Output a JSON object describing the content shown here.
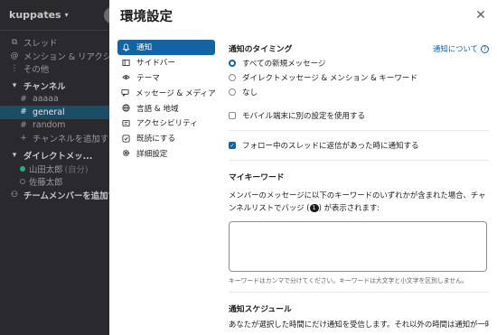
{
  "workspace": {
    "name": "kuppates",
    "nav": [
      {
        "label": "スレッド",
        "icon": "threads-icon"
      },
      {
        "label": "メンション & リアクション",
        "icon": "mention-icon"
      },
      {
        "label": "その他",
        "icon": "more-icon"
      }
    ],
    "channels_header": "チャンネル",
    "channels": [
      "aaaaa",
      "general",
      "random"
    ],
    "active_channel": "general",
    "add_channel": "チャンネルを追加する",
    "dm_header": "ダイレクトメッ...",
    "dms": [
      {
        "name": "山田太郎",
        "suffix": "(自分)",
        "online": true
      },
      {
        "name": "佐藤太郎",
        "suffix": "",
        "online": false
      }
    ],
    "add_member": "チームメンバーを追加する"
  },
  "modal": {
    "title": "環境設定",
    "close_icon": "close-icon",
    "nav": [
      {
        "label": "通知",
        "icon": "bell-icon",
        "active": true
      },
      {
        "label": "サイドバー",
        "icon": "sidebar-icon"
      },
      {
        "label": "テーマ",
        "icon": "eye-icon"
      },
      {
        "label": "メッセージ & メディア",
        "icon": "message-icon"
      },
      {
        "label": "言語 & 地域",
        "icon": "globe-icon"
      },
      {
        "label": "アクセシビリティ",
        "icon": "accessibility-icon"
      },
      {
        "label": "既読にする",
        "icon": "check-icon"
      },
      {
        "label": "詳細設定",
        "icon": "gear-icon"
      }
    ],
    "timing": {
      "title": "通知のタイミング",
      "help": "通知について",
      "options": [
        {
          "label": "すべての新規メッセージ",
          "selected": true
        },
        {
          "label": "ダイレクトメッセージ & メンション & キーワード",
          "selected": false
        },
        {
          "label": "なし",
          "selected": false
        }
      ],
      "mobile_checkbox": {
        "label": "モバイル端末に別の設定を使用する",
        "checked": false
      }
    },
    "thread_checkbox": {
      "label": "フォロー中のスレッドに返信があった時に通知する",
      "checked": true
    },
    "keywords": {
      "title": "マイキーワード",
      "desc_1": "メンバーのメッセージに以下のキーワードのいずれかが含まれた場合、チャンネルリストでバッジ (",
      "badge": "1",
      "desc_2": ") が表示されます:",
      "input_value": "",
      "hint": "キーワードはカンマで分けてください。キーワードは大文字と小文字を区別しません。"
    },
    "schedule": {
      "title": "通知スケジュール",
      "desc": "あなたが選択した時間にだけ通知を受信します。それ以外の時間は通知が一時"
    }
  },
  "colors": {
    "accent": "#1264a3",
    "active_channel_bg": "#1b4d66",
    "online": "#2bac76"
  }
}
